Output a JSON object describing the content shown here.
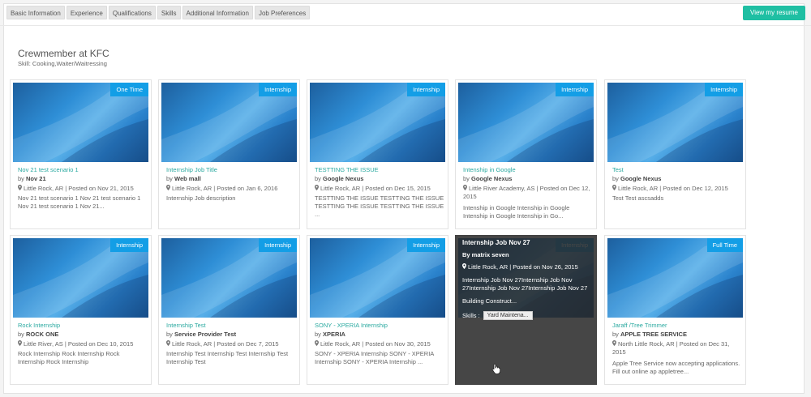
{
  "tabs": [
    {
      "label": "Basic Information"
    },
    {
      "label": "Experience"
    },
    {
      "label": "Qualifications"
    },
    {
      "label": "Skills"
    },
    {
      "label": "Additional Information"
    },
    {
      "label": "Job Preferences"
    }
  ],
  "resume_button": "View my resume",
  "position": {
    "title": "Crewmember at KFC",
    "skill": "Skill: Cooking,Waiter/Waitressing"
  },
  "cards": [
    {
      "badge": "One Time",
      "title": "Nov 21 test scenario 1",
      "by_label": "by",
      "company": "Nov 21",
      "location": "Little Rock, AR | Posted on Nov 21, 2015",
      "desc": "Nov 21 test scenario 1 Nov 21 test scenario 1 Nov 21 test scenario 1 Nov 21..."
    },
    {
      "badge": "Internship",
      "title": "Internship Job Title",
      "by_label": "by",
      "company": "Web mall",
      "location": "Little Rock, AR | Posted on Jan 6, 2016",
      "desc": "Internship Job description"
    },
    {
      "badge": "Internship",
      "title": "TESTTING THE ISSUE",
      "by_label": "by",
      "company": "Google Nexus",
      "location": "Little Rock, AR | Posted on Dec 15, 2015",
      "desc": "TESTTING THE ISSUE TESTTING THE ISSUE TESTTING THE ISSUE TESTTING THE ISSUE ..."
    },
    {
      "badge": "Internship",
      "title": "Intenship in Google",
      "by_label": "by",
      "company": "Google Nexus",
      "location": "Little River Academy, AS | Posted on Dec 12, 2015",
      "desc": "Intenship in Google Intenship in Google Intenship in Google Intenship in Go..."
    },
    {
      "badge": "Internship",
      "title": "Test",
      "by_label": "by",
      "company": "Google Nexus",
      "location": "Little Rock, AR | Posted on Dec 12, 2015",
      "desc": "Test Test ascsadds"
    },
    {
      "badge": "Internship",
      "title": "Rock Internship",
      "by_label": "by",
      "company": "ROCK ONE",
      "location": "Little River, AS | Posted on Dec 10, 2015",
      "desc": "Rock Internship Rock Internship Rock Internship Rock Internship"
    },
    {
      "badge": "Internship",
      "title": "Internship Test",
      "by_label": "by",
      "company": "Service Provider Test",
      "location": "Little Rock, AR | Posted on Dec 7, 2015",
      "desc": "Internship Test Internship Test Internship Test Internship Test"
    },
    {
      "badge": "Internship",
      "title": "SONY - XPERIA Internship",
      "by_label": "by",
      "company": "XPERIA",
      "location": "Little Rock, AR | Posted on Nov 30, 2015",
      "desc": "SONY - XPERIA Internship SONY - XPERIA Internship SONY - XPERIA Internship ..."
    },
    {
      "badge": "Internship",
      "title": "",
      "by_label": "",
      "company": "",
      "location": "",
      "desc": ""
    },
    {
      "badge": "Full Time",
      "title": "Jaraff /Tree Trimmer",
      "by_label": "by",
      "company": "APPLE TREE SERVICE",
      "location": "North Little Rock, AR | Posted on Dec 31, 2015",
      "desc": "Apple Tree Service now accepting applications. Fill out online ap appletree..."
    }
  ],
  "overlay": {
    "title": "Internship Job Nov 27",
    "by": "By matrix seven",
    "location": "Little Rock, AR | Posted on Nov 26, 2015",
    "desc": "Internship Job Nov 27Internship Job Nov 27Internship Job Nov 27Internship Job Nov 27",
    "category": "Building Construct...",
    "skills_label": "Skills :",
    "skill_chip": "Yard Maintena..."
  }
}
